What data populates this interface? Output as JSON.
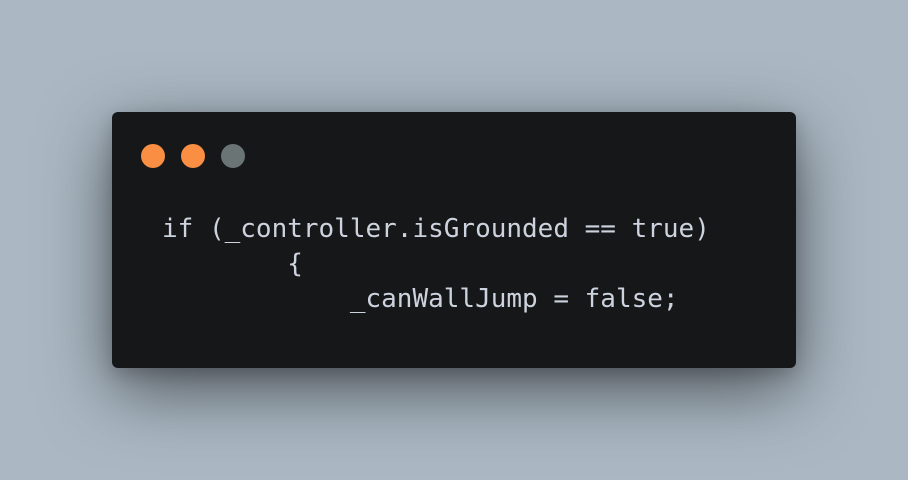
{
  "window": {
    "controls": [
      {
        "name": "close-dot",
        "color": "#fa8f43"
      },
      {
        "name": "minimize-dot",
        "color": "#fa8f43"
      },
      {
        "name": "zoom-dot",
        "color": "#6b7474"
      }
    ]
  },
  "code": {
    "lines": [
      "if (_controller.isGrounded == true)",
      "        {",
      "            _canWallJump = false;"
    ]
  },
  "colors": {
    "background": "#abb8c3",
    "window": "#151718",
    "text": "#cdd3de"
  }
}
